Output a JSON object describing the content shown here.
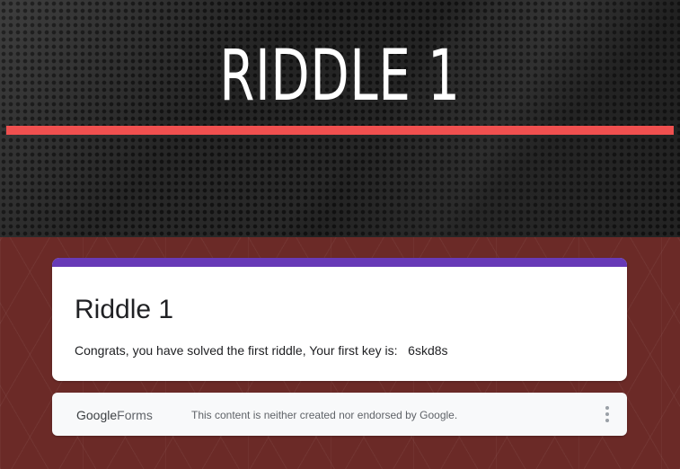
{
  "banner": {
    "title": "RIDDLE 1",
    "accent_color": "#f0504f"
  },
  "form": {
    "accent_color": "#673ab7",
    "title": "Riddle 1",
    "message": "Congrats, you have solved the first riddle, Your first key is:   6skd8s"
  },
  "footer": {
    "logo_google": "Google",
    "logo_forms": "Forms",
    "note": "This content is neither created nor endorsed by Google.",
    "menu_icon": "more-vert-icon"
  }
}
